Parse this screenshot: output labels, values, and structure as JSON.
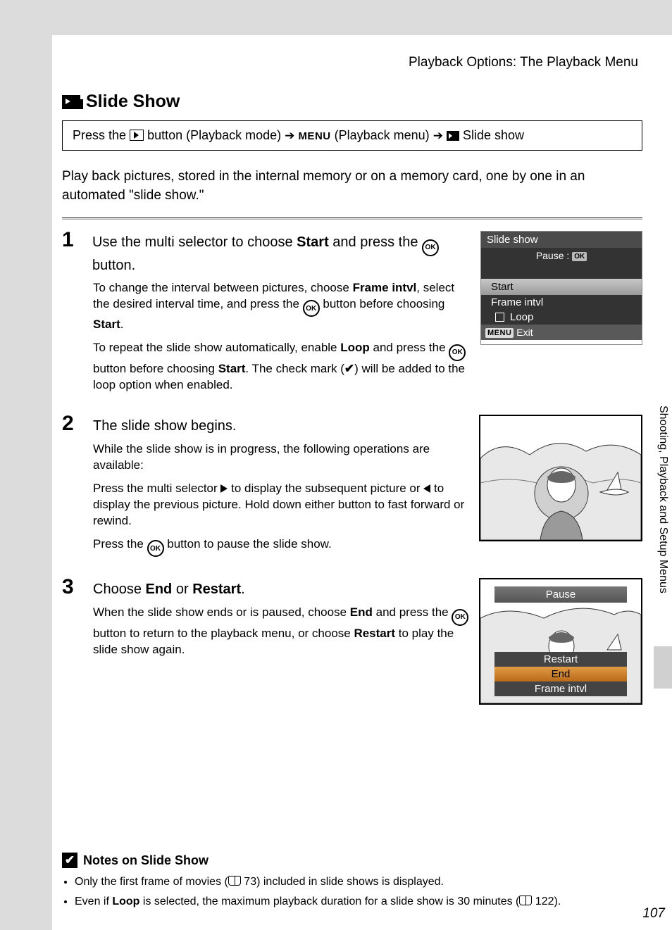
{
  "header": "Playback Options: The Playback Menu",
  "title": "Slide Show",
  "path": {
    "p1": "Press the ",
    "p2": " button (Playback mode) ",
    "menu_word": "MENU",
    "p3": " (Playback menu) ",
    "p4": " Slide show"
  },
  "intro": "Play back pictures, stored in the internal memory or on a memory card, one by one in an automated \"slide show.\"",
  "steps": [
    {
      "num": "1",
      "title_pre": "Use the multi selector to choose ",
      "title_b1": "Start",
      "title_mid": " and press the ",
      "title_post": " button.",
      "body1_pre": "To change the interval between pictures, choose ",
      "body1_b1": "Frame intvl",
      "body1_mid": ", select the desired interval time, and press the ",
      "body1_post": " button before choosing ",
      "body1_b2": "Start",
      "body1_end": ".",
      "body2_pre": "To repeat the slide show automatically, enable ",
      "body2_b1": "Loop",
      "body2_mid": " and press the ",
      "body2_post": " button before choosing ",
      "body2_b2": "Start",
      "body2_after": ". The check mark (",
      "body2_end": ") will be added to the loop option when enabled."
    },
    {
      "num": "2",
      "title": "The slide show begins.",
      "body1": "While the slide show is in progress, the following operations are available:",
      "body2_pre": "Press the multi selector ",
      "body2_mid": " to display the subsequent picture or ",
      "body2_post": " to display the previous picture. Hold down either button to fast forward or rewind.",
      "body3_pre": "Press the ",
      "body3_post": " button to pause the slide show."
    },
    {
      "num": "3",
      "title_pre": "Choose ",
      "title_b1": "End",
      "title_mid": " or ",
      "title_b2": "Restart",
      "title_post": ".",
      "body1_pre": "When the slide show ends or is paused, choose ",
      "body1_b1": "End",
      "body1_mid": " and press the ",
      "body1_post": " button to return to the playback menu, or choose ",
      "body1_b2": "Restart",
      "body1_end": " to play the slide show again."
    }
  ],
  "screen1": {
    "title": "Slide show",
    "pause_label": "Pause",
    "ok_tag": "OK",
    "start": "Start",
    "frame": "Frame intvl",
    "loop": "Loop",
    "menu_tag": "MENU",
    "exit": "Exit"
  },
  "screen3": {
    "pause": "Pause",
    "restart": "Restart",
    "end": "End",
    "frame": "Frame intvl"
  },
  "side_tab": "Shooting, Playback and Setup Menus",
  "notes": {
    "title": "Notes on Slide Show",
    "n1_pre": "Only the first frame of movies (",
    "n1_ref": " 73) included in slide shows is displayed.",
    "n2_pre": "Even if ",
    "n2_b": "Loop",
    "n2_mid": " is selected, the maximum playback duration for a slide show is 30 minutes (",
    "n2_ref": " 122)."
  },
  "page_num": "107"
}
